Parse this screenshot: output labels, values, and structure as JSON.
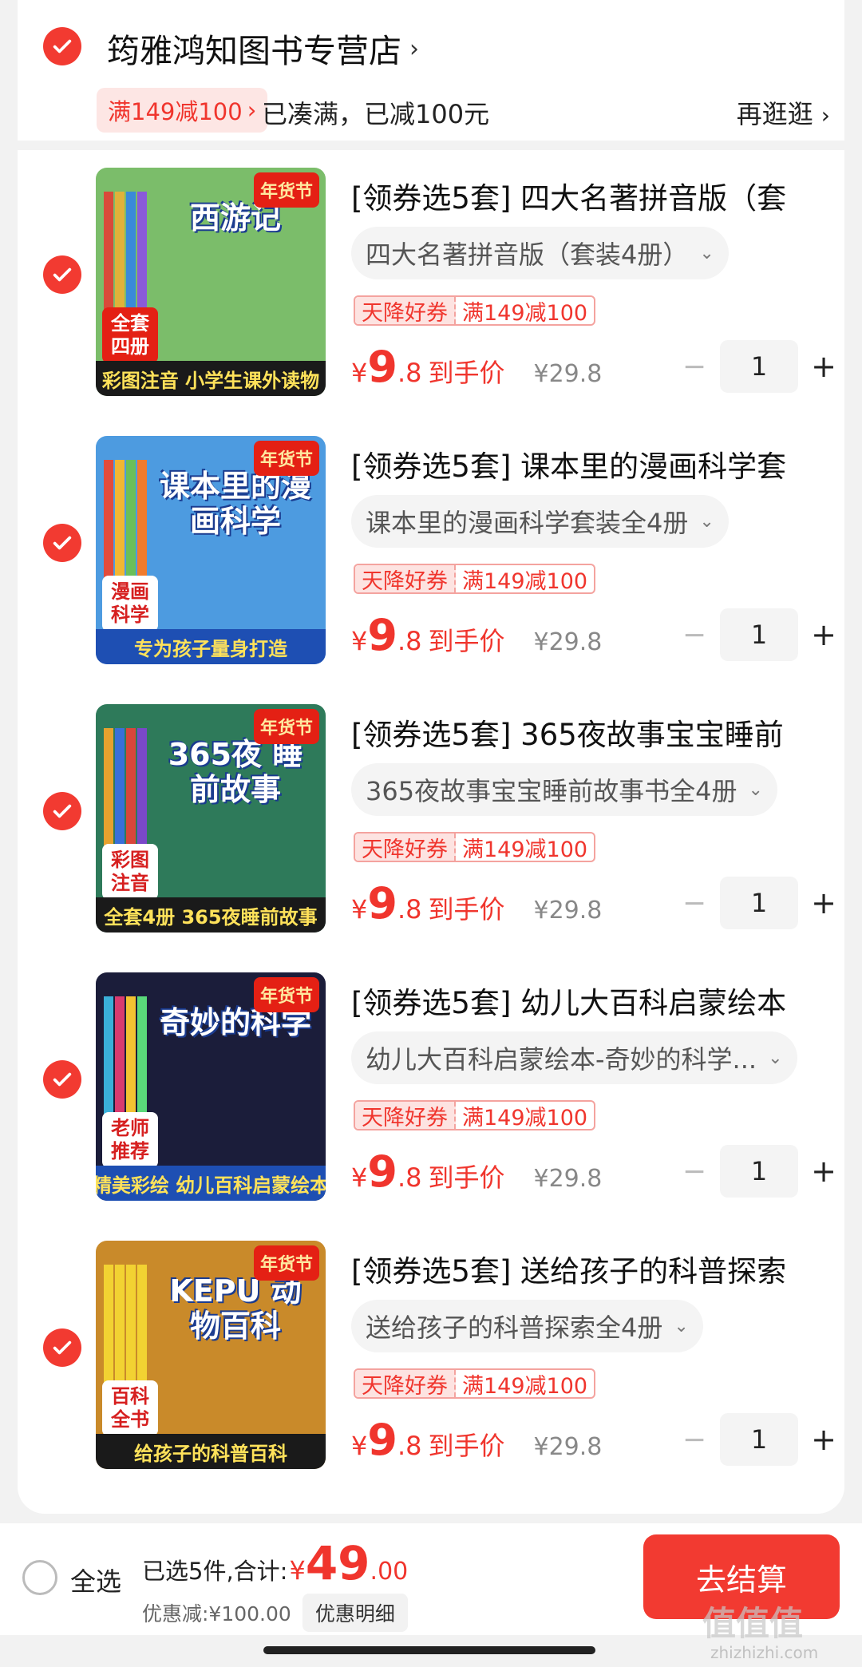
{
  "store": {
    "name": "筠雅鸿知图书专营店",
    "promo_tag": "满149减100",
    "promo_status": "已凑满，已减100元",
    "shop_more": "再逛逛"
  },
  "items": [
    {
      "title": "[领券选5套] 四大名著拼音版（套",
      "variant": "四大名著拼音版（套装4册）",
      "coupon_label": "天降好券",
      "coupon_value": "满149减100",
      "price_symbol": "¥",
      "price_int": "9",
      "price_dec": ".8",
      "price_label": "到手价",
      "original_price": "¥29.8",
      "quantity": "1",
      "cover": {
        "title": "西游记",
        "badge": "年货节",
        "corner": "全套四册",
        "banner": "彩图注音 小学生课外读物",
        "bg": "#7bbd6a",
        "spines": [
          "#d94a3a",
          "#e0b23a",
          "#3a8ad9",
          "#8a5ad9"
        ]
      }
    },
    {
      "title": "[领券选5套] 课本里的漫画科学套",
      "variant": "课本里的漫画科学套装全4册",
      "coupon_label": "天降好券",
      "coupon_value": "满149减100",
      "price_symbol": "¥",
      "price_int": "9",
      "price_dec": ".8",
      "price_label": "到手价",
      "original_price": "¥29.8",
      "quantity": "1",
      "cover": {
        "title": "课本里的漫画科学",
        "badge": "年货节",
        "corner": "漫画科学",
        "banner": "专为孩子量身打造",
        "bg": "#4d9be0",
        "spines": [
          "#e24b3b",
          "#f2b632",
          "#6bbf59",
          "#f07b2d"
        ]
      }
    },
    {
      "title": "[领券选5套] 365夜故事宝宝睡前",
      "variant": "365夜故事宝宝睡前故事书全4册",
      "coupon_label": "天降好券",
      "coupon_value": "满149减100",
      "price_symbol": "¥",
      "price_int": "9",
      "price_dec": ".8",
      "price_label": "到手价",
      "original_price": "¥29.8",
      "quantity": "1",
      "cover": {
        "title": "365夜 睡前故事",
        "badge": "年货节",
        "corner": "彩图注音",
        "banner": "全套4册 365夜睡前故事",
        "bg": "#2e7a5a",
        "spines": [
          "#e6a12e",
          "#3a6fd9",
          "#d9463a",
          "#7a48c9"
        ]
      }
    },
    {
      "title": "[领券选5套] 幼儿大百科启蒙绘本",
      "variant": "幼儿大百科启蒙绘本-奇妙的科学...",
      "coupon_label": "天降好券",
      "coupon_value": "满149减100",
      "price_symbol": "¥",
      "price_int": "9",
      "price_dec": ".8",
      "price_label": "到手价",
      "original_price": "¥29.8",
      "quantity": "1",
      "cover": {
        "title": "奇妙的科学",
        "badge": "年货节",
        "corner": "老师推荐",
        "banner": "精美彩绘 幼儿百科启蒙绘本",
        "bg": "#1b1d3a",
        "spines": [
          "#3ab0d9",
          "#d93a6f",
          "#f2c232",
          "#5ad97a"
        ]
      }
    },
    {
      "title": "[领券选5套] 送给孩子的科普探索",
      "variant": "送给孩子的科普探索全4册",
      "coupon_label": "天降好券",
      "coupon_value": "满149减100",
      "price_symbol": "¥",
      "price_int": "9",
      "price_dec": ".8",
      "price_label": "到手价",
      "original_price": "¥29.8",
      "quantity": "1",
      "cover": {
        "title": "KEPU 动物百科",
        "badge": "年货节",
        "corner": "百科全书",
        "banner": "给孩子的科普百科",
        "bg": "#c98a2a",
        "spines": [
          "#f2d232",
          "#f2d232",
          "#f2d232",
          "#f2d232"
        ]
      }
    }
  ],
  "footer": {
    "select_all": "全选",
    "selected_summary": "已选5件,合计:",
    "total_symbol": "¥",
    "total_int": "49",
    "total_dec": ".00",
    "discount_text": "优惠减:¥100.00",
    "discount_detail": "优惠明细",
    "checkout": "去结算"
  },
  "watermark": {
    "main": "值值值",
    "sub": "zhizhizhi.com"
  },
  "colors": {
    "accent": "#f23a31",
    "coupon_bg": "#fde3e1"
  }
}
